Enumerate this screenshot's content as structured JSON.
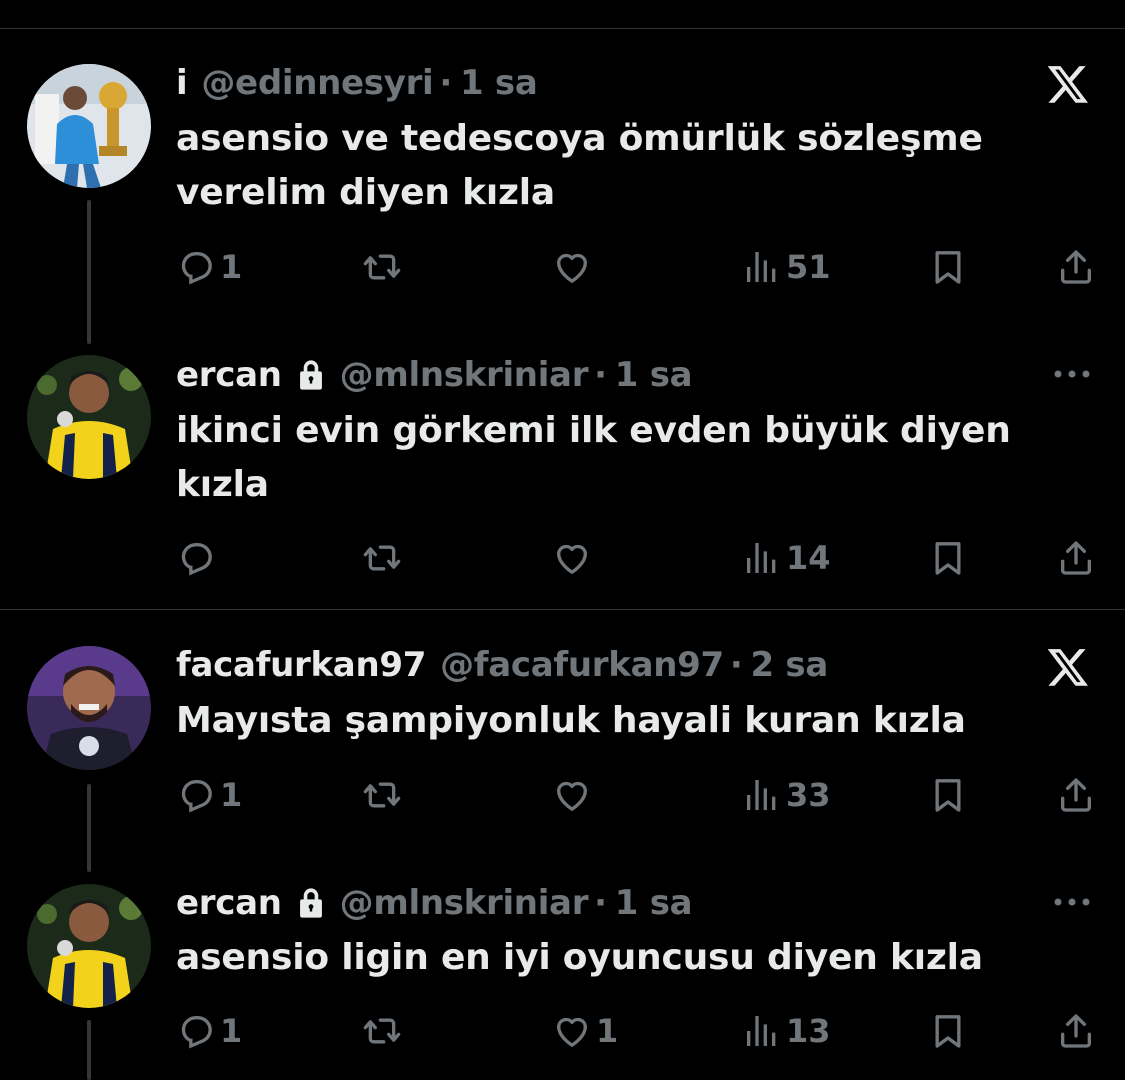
{
  "tweets": [
    {
      "name": "i",
      "handle": "@edinnesyri",
      "dot": "·",
      "time": "1 sa",
      "text": "asensio ve tedescoya ömürlük sözleşme verelim diyen kızla",
      "locked": false,
      "corner_icon": "x-logo-icon",
      "counts": {
        "reply": "1",
        "retweet": "",
        "like": "",
        "views": "51"
      }
    },
    {
      "name": "ercan",
      "handle": "@mlnskriniar",
      "dot": "·",
      "time": "1 sa",
      "text": "ikinci evin görkemi ilk evden büyük diyen kızla",
      "locked": true,
      "corner_icon": "more-icon",
      "counts": {
        "reply": "",
        "retweet": "",
        "like": "",
        "views": "14"
      }
    },
    {
      "name": "facafurkan97",
      "handle": "@facafurkan97",
      "dot": "·",
      "time": "2 sa",
      "text": "Mayısta şampiyonluk hayali kuran kızla",
      "locked": false,
      "corner_icon": "x-logo-icon",
      "counts": {
        "reply": "1",
        "retweet": "",
        "like": "",
        "views": "33"
      }
    },
    {
      "name": "ercan",
      "handle": "@mlnskriniar",
      "dot": "·",
      "time": "1 sa",
      "text": "asensio ligin en iyi oyuncusu diyen kızla",
      "locked": true,
      "corner_icon": "more-icon",
      "counts": {
        "reply": "1",
        "retweet": "",
        "like": "1",
        "views": "13"
      }
    }
  ],
  "icons": [
    "reply-icon",
    "retweet-icon",
    "like-icon",
    "views-icon",
    "bookmark-icon",
    "share-icon",
    "lock-icon"
  ],
  "colors": {
    "background": "#000000",
    "text": "#e7e9ea",
    "secondary": "#71767b",
    "divider": "#2f3336",
    "thread_line": "#333639"
  }
}
